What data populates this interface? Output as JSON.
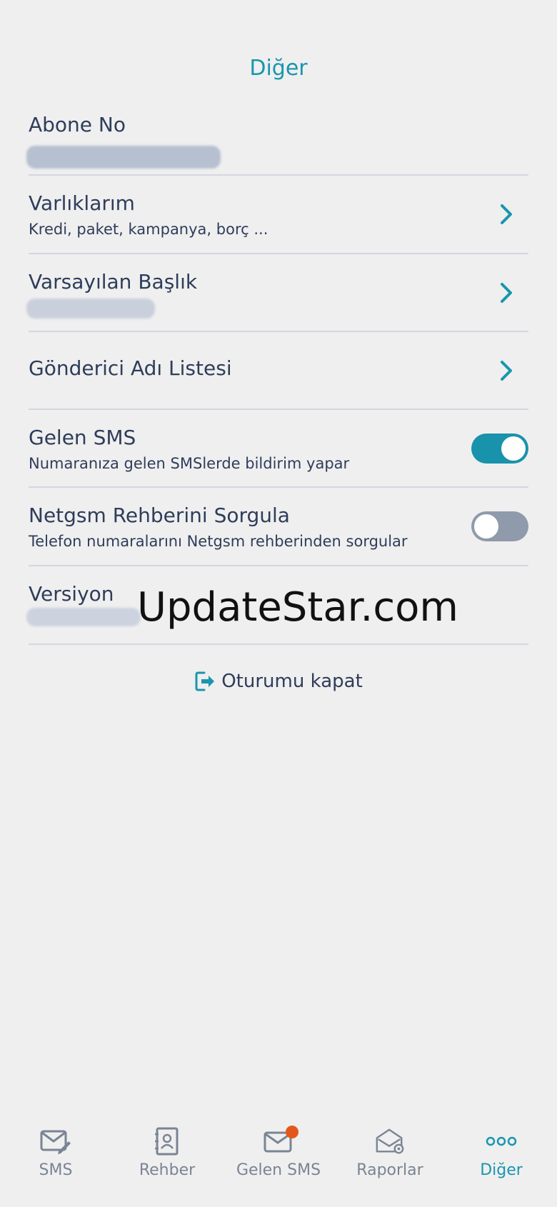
{
  "header": {
    "title": "Diğer"
  },
  "rows": {
    "abone": {
      "title": "Abone No"
    },
    "varliklarim": {
      "title": "Varlıklarım",
      "subtitle": "Kredi, paket, kampanya, borç ..."
    },
    "varsayilan": {
      "title": "Varsayılan Başlık"
    },
    "gonderici": {
      "title": "Gönderici Adı Listesi"
    },
    "gelen_sms": {
      "title": "Gelen SMS",
      "subtitle": "Numaranıza gelen SMSlerde bildirim yapar",
      "toggle": "on"
    },
    "netgsm": {
      "title": "Netgsm Rehberini Sorgula",
      "subtitle": "Telefon numaralarını Netgsm rehberinden sorgular",
      "toggle": "off"
    },
    "versiyon": {
      "title": "Versiyon"
    }
  },
  "watermark": "UpdateStar.com",
  "logout": {
    "label": "Oturumu kapat",
    "icon": "logout-icon"
  },
  "tabs": [
    {
      "label": "SMS",
      "icon": "sms-compose-icon"
    },
    {
      "label": "Rehber",
      "icon": "contacts-book-icon"
    },
    {
      "label": "Gelen SMS",
      "icon": "inbox-mail-icon"
    },
    {
      "label": "Raporlar",
      "icon": "reports-icon"
    },
    {
      "label": "Diğer",
      "icon": "more-dots-icon"
    }
  ],
  "colors": {
    "accent": "#1996ad",
    "text": "#2f3d5a",
    "background": "#efefef",
    "toggle_on": "#1992ab",
    "toggle_off": "#8f9aab",
    "badge": "#e4571c"
  }
}
